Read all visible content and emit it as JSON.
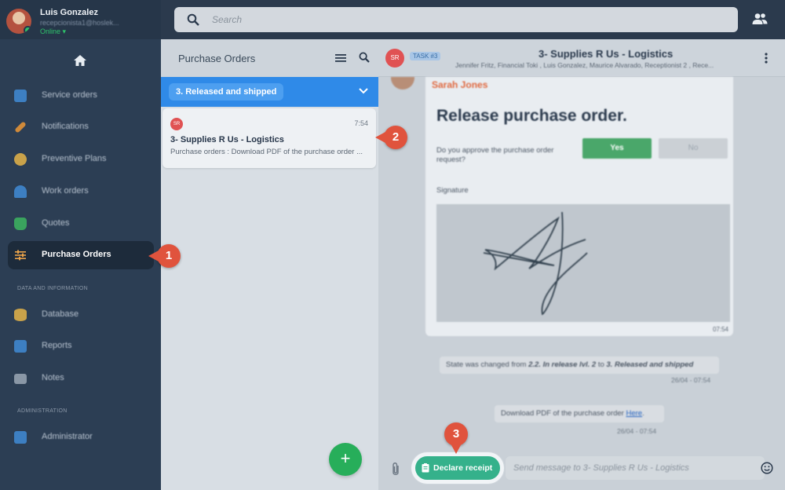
{
  "user": {
    "name": "Luis Gonzalez",
    "email": "recepcionista1@hoslek...",
    "status": "Online"
  },
  "search": {
    "placeholder": "Search"
  },
  "sidebar": {
    "items": [
      {
        "label": "Service orders",
        "icon": "briefcase-icon",
        "color": "#3d7fc2"
      },
      {
        "label": "Notifications",
        "icon": "wrench-icon",
        "color": "#d08a3a"
      },
      {
        "label": "Preventive Plans",
        "icon": "gear-icon",
        "color": "#c9a24a"
      },
      {
        "label": "Work orders",
        "icon": "worker-icon",
        "color": "#3d7fc2"
      },
      {
        "label": "Quotes",
        "icon": "money-bag-icon",
        "color": "#3aa35e"
      },
      {
        "label": "Purchase Orders",
        "icon": "sliders-icon",
        "color": "#d08a3a",
        "active": true
      }
    ],
    "section_data": "DATA AND INFORMATION",
    "data_items": [
      {
        "label": "Database",
        "icon": "database-icon",
        "color": "#c9a24a"
      },
      {
        "label": "Reports",
        "icon": "report-icon",
        "color": "#3d7fc2"
      },
      {
        "label": "Notes",
        "icon": "folder-icon",
        "color": "#8a97a6"
      }
    ],
    "section_admin": "ADMINISTRATION",
    "admin_items": [
      {
        "label": "Administrator",
        "icon": "admin-icon",
        "color": "#3d7fc2"
      }
    ]
  },
  "po_list": {
    "title": "Purchase Orders",
    "group": "3. Released and shipped",
    "card": {
      "avatar": "SR",
      "time": "7:54",
      "title": "3- Supplies R Us - Logistics",
      "preview": "Purchase orders : Download PDF of the purchase order ..."
    },
    "fab": "+"
  },
  "chat": {
    "avatar": "SR",
    "task": "TASK #3",
    "title": "3- Supplies R Us - Logistics",
    "participants": "Jennifer Fritz, Financial Toki , Luis Gonzalez, Maurice Alvarado, Receptionist 2 , Rece...",
    "message": {
      "sender": "Sarah Jones",
      "heading": "Release purchase order.",
      "question": "Do you approve the purchase order request?",
      "yes": "Yes",
      "no": "No",
      "signature_label": "Signature",
      "time": "07:54"
    },
    "state_change": {
      "prefix": "State was changed from ",
      "from": "2.2. In release lvl. 2",
      "to_word": " to ",
      "to": "3. Released and shipped",
      "time": "26/04 - 07:54"
    },
    "download": {
      "text": "Download PDF of the purchase order ",
      "link": "Here",
      "suffix": ".",
      "time": "26/04 - 07:54"
    },
    "declare_button": "Declare receipt",
    "input_placeholder": "Send message to 3- Supplies R Us - Logistics"
  },
  "callouts": [
    "1",
    "2",
    "3"
  ],
  "colors": {
    "accent": "#2f8ae8",
    "callout": "#e0533d",
    "declare": "#35b18b",
    "yes": "#4aa76a"
  }
}
